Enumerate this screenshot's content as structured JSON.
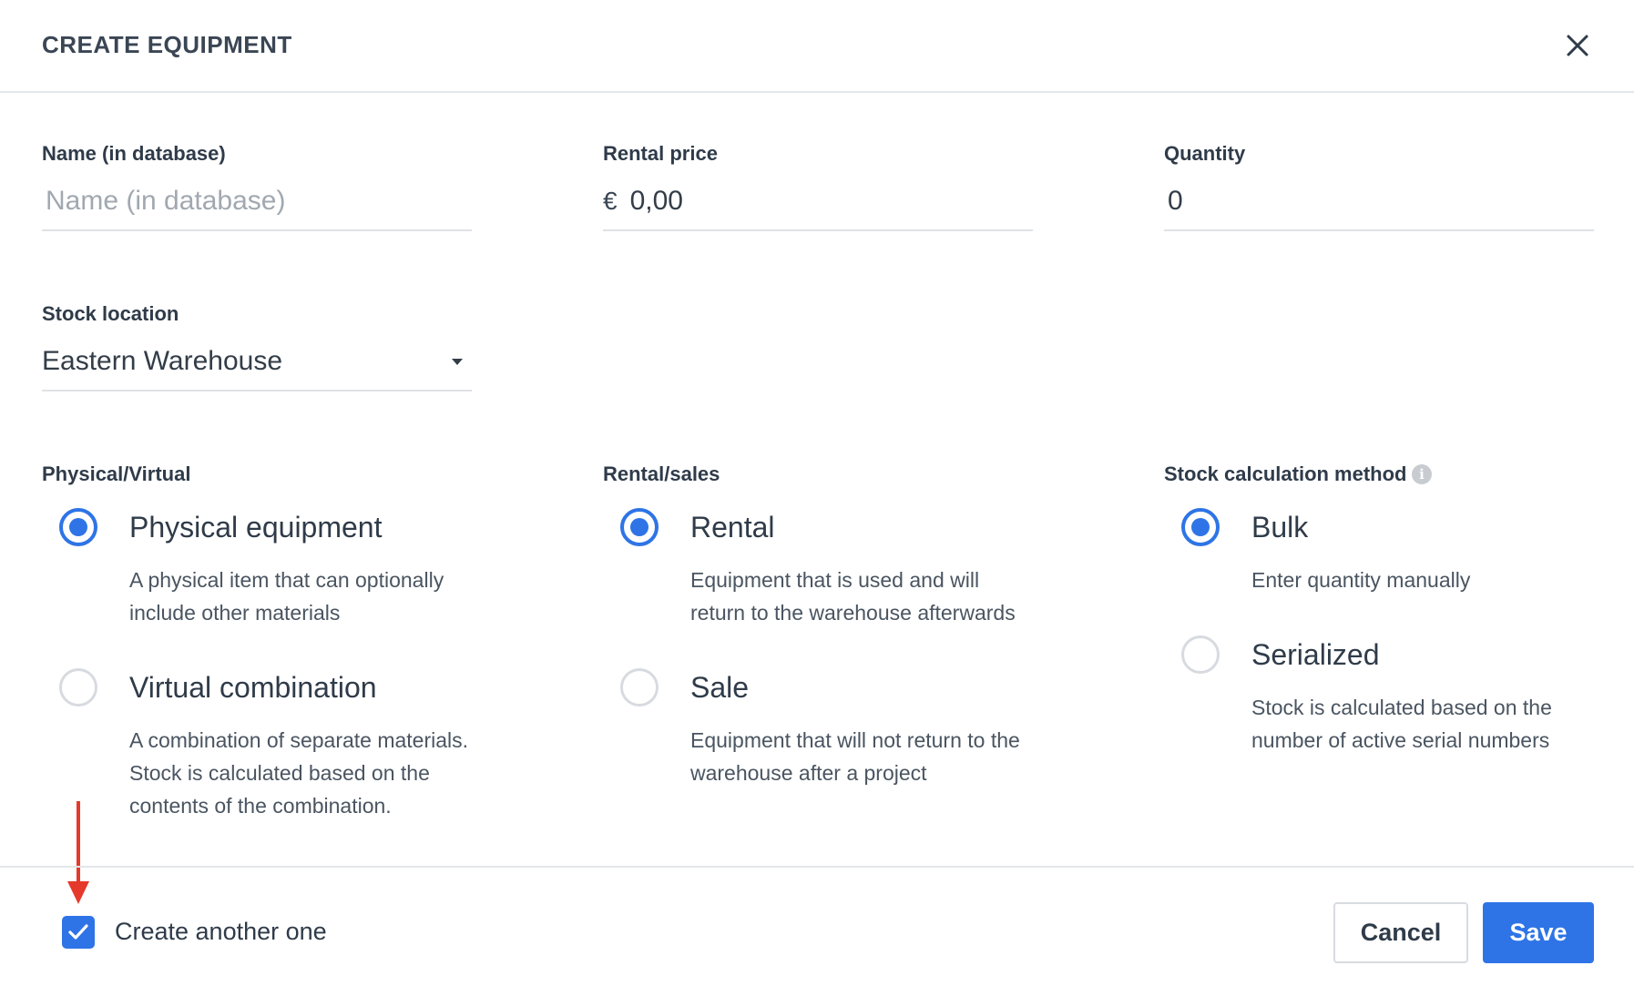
{
  "dialog": {
    "title": "CREATE EQUIPMENT",
    "close_icon": "close-icon"
  },
  "fields": {
    "name": {
      "label": "Name (in database)",
      "value": "",
      "placeholder": "Name (in database)"
    },
    "rental_price": {
      "label": "Rental price",
      "currency": "€",
      "value": "0,00"
    },
    "quantity": {
      "label": "Quantity",
      "value": "0"
    },
    "stock_location": {
      "label": "Stock location",
      "value": "Eastern Warehouse"
    }
  },
  "physical_virtual": {
    "label": "Physical/Virtual",
    "options": [
      {
        "label": "Physical equipment",
        "desc_1": "A physical item that can optionally",
        "desc_2": "include other materials",
        "selected": true
      },
      {
        "label": "Virtual combination",
        "desc_1": "A combination of separate materials.",
        "desc_2": "Stock is calculated based on the",
        "desc_3": "contents of the combination.",
        "selected": false
      }
    ]
  },
  "rental_sales": {
    "label": "Rental/sales",
    "options": [
      {
        "label": "Rental",
        "desc_1": "Equipment that is used and will",
        "desc_2": "return to the warehouse afterwards",
        "selected": true
      },
      {
        "label": "Sale",
        "desc_1": "Equipment that will not return to the",
        "desc_2": "warehouse after a project",
        "selected": false
      }
    ]
  },
  "stock_calculation": {
    "label": "Stock calculation method",
    "info_icon": "info-icon",
    "options": [
      {
        "label": "Bulk",
        "desc_1": "Enter quantity manually",
        "selected": true
      },
      {
        "label": "Serialized",
        "desc_1": "Stock is calculated based on the",
        "desc_2": "number of active serial numbers",
        "selected": false
      }
    ]
  },
  "footer": {
    "create_another_label": "Create another one",
    "create_another_checked": true,
    "cancel_label": "Cancel",
    "save_label": "Save"
  },
  "colors": {
    "accent": "#2e74e6",
    "annotation_arrow": "#e53a2b"
  }
}
